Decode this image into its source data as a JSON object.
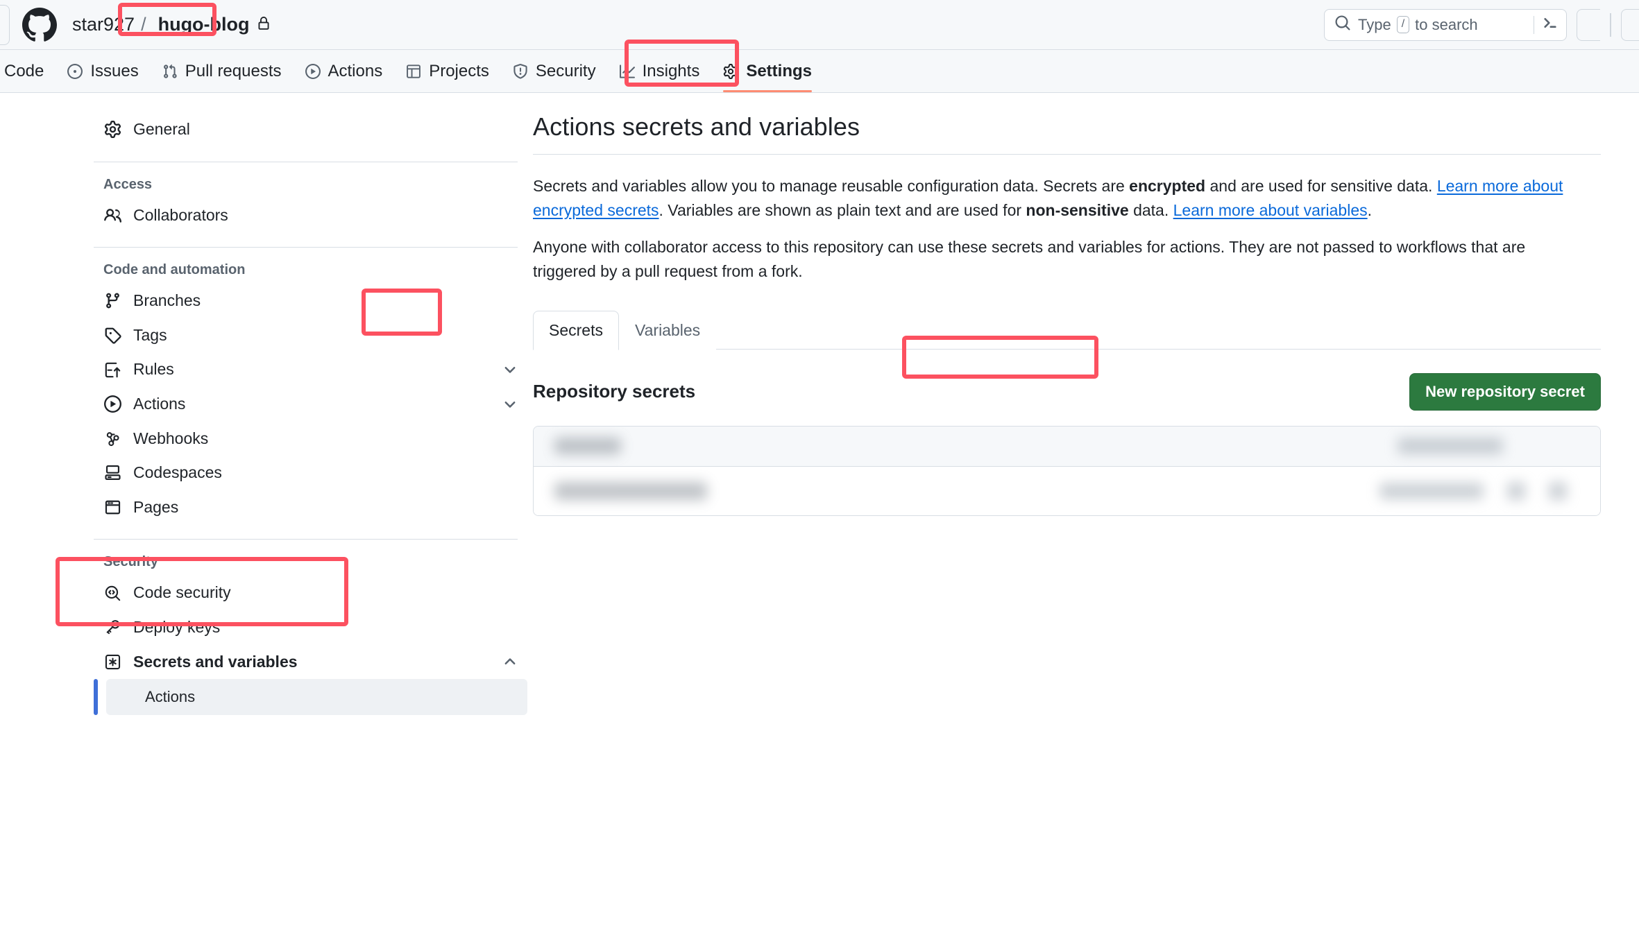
{
  "header": {
    "owner": "star927",
    "separator": "/",
    "repo": "hugo-blog",
    "lock_icon": "lock-icon",
    "logo_icon": "github-mark-icon",
    "search": {
      "icon": "search-icon",
      "prefix": "Type",
      "key": "/",
      "suffix": "to search",
      "full_placeholder": "Type / to search",
      "terminal_icon": "command-palette-icon"
    }
  },
  "repo_nav": {
    "items": [
      {
        "label": "Code",
        "icon": "code-icon",
        "selected": false
      },
      {
        "label": "Issues",
        "icon": "issue-opened-icon",
        "selected": false
      },
      {
        "label": "Pull requests",
        "icon": "git-pull-request-icon",
        "selected": false
      },
      {
        "label": "Actions",
        "icon": "play-icon",
        "selected": false
      },
      {
        "label": "Projects",
        "icon": "table-icon",
        "selected": false
      },
      {
        "label": "Security",
        "icon": "shield-icon",
        "selected": false
      },
      {
        "label": "Insights",
        "icon": "graph-icon",
        "selected": false
      },
      {
        "label": "Settings",
        "icon": "gear-icon",
        "selected": true
      }
    ]
  },
  "sidebar": {
    "general": {
      "label": "General",
      "icon": "gear-icon"
    },
    "groups": [
      {
        "heading": "Access",
        "items": [
          {
            "label": "Collaborators",
            "icon": "people-icon",
            "chevron": null
          }
        ]
      },
      {
        "heading": "Code and automation",
        "items": [
          {
            "label": "Branches",
            "icon": "git-branch-icon",
            "chevron": null
          },
          {
            "label": "Tags",
            "icon": "tag-icon",
            "chevron": null
          },
          {
            "label": "Rules",
            "icon": "rules-icon",
            "chevron": "chevron-down-icon"
          },
          {
            "label": "Actions",
            "icon": "play-icon",
            "chevron": "chevron-down-icon"
          },
          {
            "label": "Webhooks",
            "icon": "webhook-icon",
            "chevron": null
          },
          {
            "label": "Codespaces",
            "icon": "codespaces-icon",
            "chevron": null
          },
          {
            "label": "Pages",
            "icon": "browser-icon",
            "chevron": null
          }
        ]
      },
      {
        "heading": "Security",
        "items": [
          {
            "label": "Code security",
            "icon": "codescan-icon",
            "chevron": null
          },
          {
            "label": "Deploy keys",
            "icon": "key-icon",
            "chevron": null
          },
          {
            "label": "Secrets and variables",
            "icon": "asterisk-icon",
            "chevron": "chevron-up-icon",
            "bold": true
          }
        ]
      }
    ],
    "sub_item": {
      "label": "Actions",
      "selected": true
    }
  },
  "main": {
    "title": "Actions secrets and variables",
    "paragraph1": {
      "part1": "Secrets and variables allow you to manage reusable configuration data. Secrets are ",
      "bold1": "encrypted",
      "part2": " and are used for sensitive data. ",
      "link1": "Learn more about encrypted secrets",
      "part3": ". Variables are shown as plain text and are used for ",
      "bold2": "non-sensitive",
      "part4": " data. ",
      "link2": "Learn more about variables",
      "part5": "."
    },
    "paragraph2": "Anyone with collaborator access to this repository can use these secrets and variables for actions. They are not passed to workflows that are triggered by a pull request from a fork.",
    "tabs": [
      {
        "label": "Secrets",
        "active": true
      },
      {
        "label": "Variables",
        "active": false
      }
    ],
    "section_heading": "Repository secrets",
    "new_secret_button": "New repository secret",
    "secrets_rows": [
      {
        "name_redacted": true,
        "meta_redacted": true,
        "actions_redacted": false
      },
      {
        "name_redacted": true,
        "meta_redacted": true,
        "actions_redacted": true
      }
    ]
  },
  "annotations": {
    "color": "#fc5160",
    "boxes": [
      {
        "target": "repo-name"
      },
      {
        "target": "settings-tab"
      },
      {
        "target": "secrets-tab"
      },
      {
        "target": "new-repository-secret-button"
      },
      {
        "target": "sidebar-secrets-and-variables"
      }
    ]
  }
}
